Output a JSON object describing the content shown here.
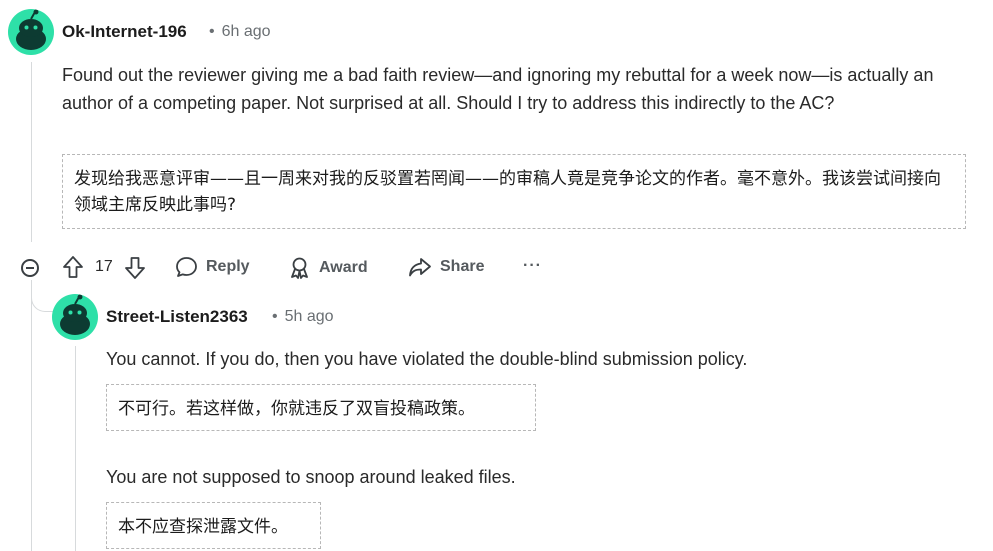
{
  "comment1": {
    "author": "Ok-Internet-196",
    "separator": "•",
    "time": "6h ago",
    "body": "Found out the reviewer giving me a bad faith review—and ignoring my rebuttal for a week now—is actually an author of a competing paper. Not surprised at all. Should I try to address this indirectly to the AC?",
    "translation": "发现给我恶意评审——且一周来对我的反驳置若罔闻——的审稿人竟是竞争论文的作者。毫不意外。我该尝试间接向领域主席反映此事吗?",
    "actions": {
      "vote_count": "17",
      "reply_label": "Reply",
      "award_label": "Award",
      "share_label": "Share",
      "more_label": "···"
    }
  },
  "comment2": {
    "author": "Street-Listen2363",
    "separator": "•",
    "time": "5h ago",
    "paragraph1": "You cannot. If you do, then you have violated the double-blind submission policy.",
    "translation1": "不可行。若这样做，你就违反了双盲投稿政策。",
    "paragraph2": "You are not supposed to snoop around leaked files.",
    "translation2": "本不应查探泄露文件。"
  },
  "colors": {
    "avatar_bg": "#2ee0a8",
    "avatar_fg": "#0d3b32",
    "thread_line": "#d7dadc",
    "dashed_border": "#b7b7b7"
  },
  "icons": [
    "collapse-icon",
    "upvote-icon",
    "downvote-icon",
    "comment-icon",
    "award-icon",
    "share-icon",
    "more-icon"
  ]
}
